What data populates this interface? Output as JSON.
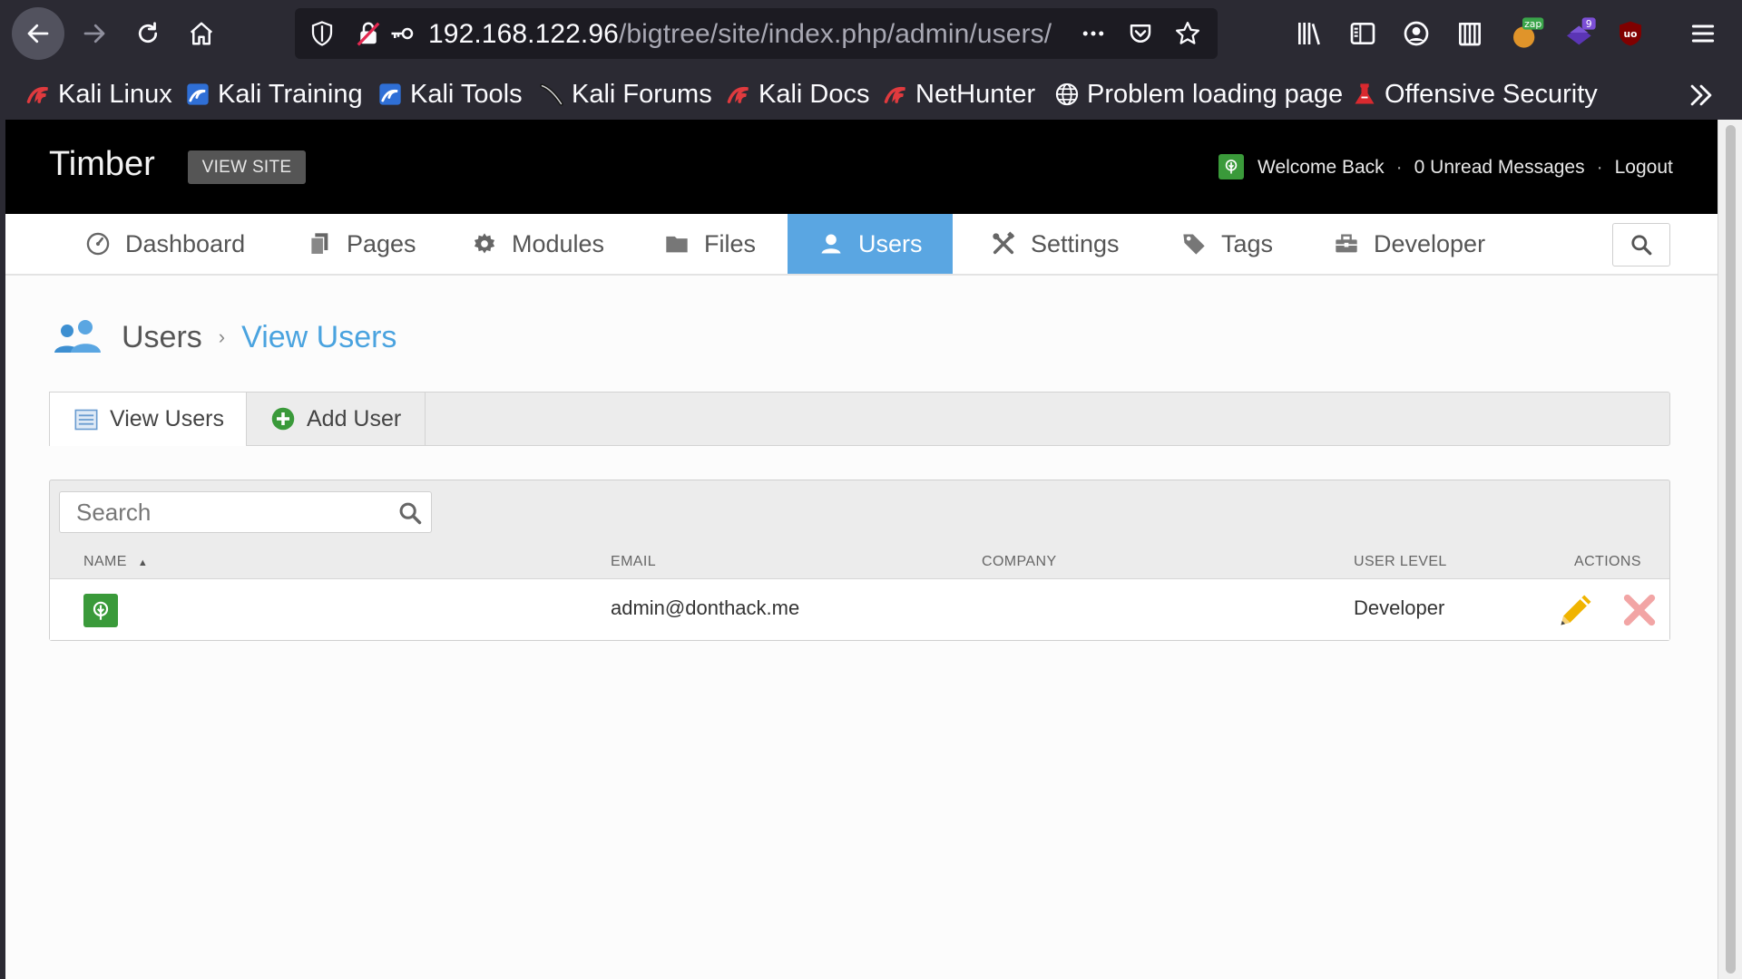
{
  "browser": {
    "url_host": "192.168.122.96",
    "url_path": "/bigtree/site/index.php/admin/users/",
    "extension_badges": {
      "zap": "zap",
      "count": "9"
    },
    "bookmarks": [
      {
        "label": "Kali Linux",
        "icon": "kali-dragon-icon"
      },
      {
        "label": "Kali Training",
        "icon": "kali-training-icon"
      },
      {
        "label": "Kali Tools",
        "icon": "kali-tools-icon"
      },
      {
        "label": "Kali Forums",
        "icon": "kali-forums-icon"
      },
      {
        "label": "Kali Docs",
        "icon": "kali-dragon-icon"
      },
      {
        "label": "NetHunter",
        "icon": "kali-dragon-icon"
      },
      {
        "label": "Problem loading page",
        "icon": "globe-icon"
      },
      {
        "label": "Offensive Security",
        "icon": "offsec-icon"
      }
    ]
  },
  "header": {
    "site_title": "Timber",
    "view_site": "VIEW SITE",
    "welcome": "Welcome Back",
    "separator": "·",
    "unread": "0 Unread Messages",
    "logout": "Logout"
  },
  "nav": [
    {
      "label": "Dashboard",
      "icon": "dashboard-icon",
      "active": false
    },
    {
      "label": "Pages",
      "icon": "pages-icon",
      "active": false
    },
    {
      "label": "Modules",
      "icon": "gear-icon",
      "active": false
    },
    {
      "label": "Files",
      "icon": "folder-icon",
      "active": false
    },
    {
      "label": "Users",
      "icon": "user-icon",
      "active": true
    },
    {
      "label": "Settings",
      "icon": "tools-icon",
      "active": false
    },
    {
      "label": "Tags",
      "icon": "tag-icon",
      "active": false
    },
    {
      "label": "Developer",
      "icon": "toolbox-icon",
      "active": false
    }
  ],
  "breadcrumb": {
    "section": "Users",
    "separator": "›",
    "current": "View Users"
  },
  "subtabs": [
    {
      "label": "View Users",
      "icon": "list-icon",
      "active": true
    },
    {
      "label": "Add User",
      "icon": "plus-circle-icon",
      "active": false
    }
  ],
  "table": {
    "search_placeholder": "Search",
    "columns": [
      "NAME",
      "EMAIL",
      "COMPANY",
      "USER LEVEL",
      "ACTIONS"
    ],
    "sort_indicator": "▲",
    "rows": [
      {
        "name": "",
        "email": "admin@donthack.me",
        "company": "",
        "user_level": "Developer"
      }
    ]
  },
  "colors": {
    "accent": "#5aa6e2",
    "link": "#4aa3df",
    "header_bg": "#000000",
    "avatar_green": "#3a9a3a",
    "edit": "#f0b400",
    "delete": "#f2a5a5"
  }
}
